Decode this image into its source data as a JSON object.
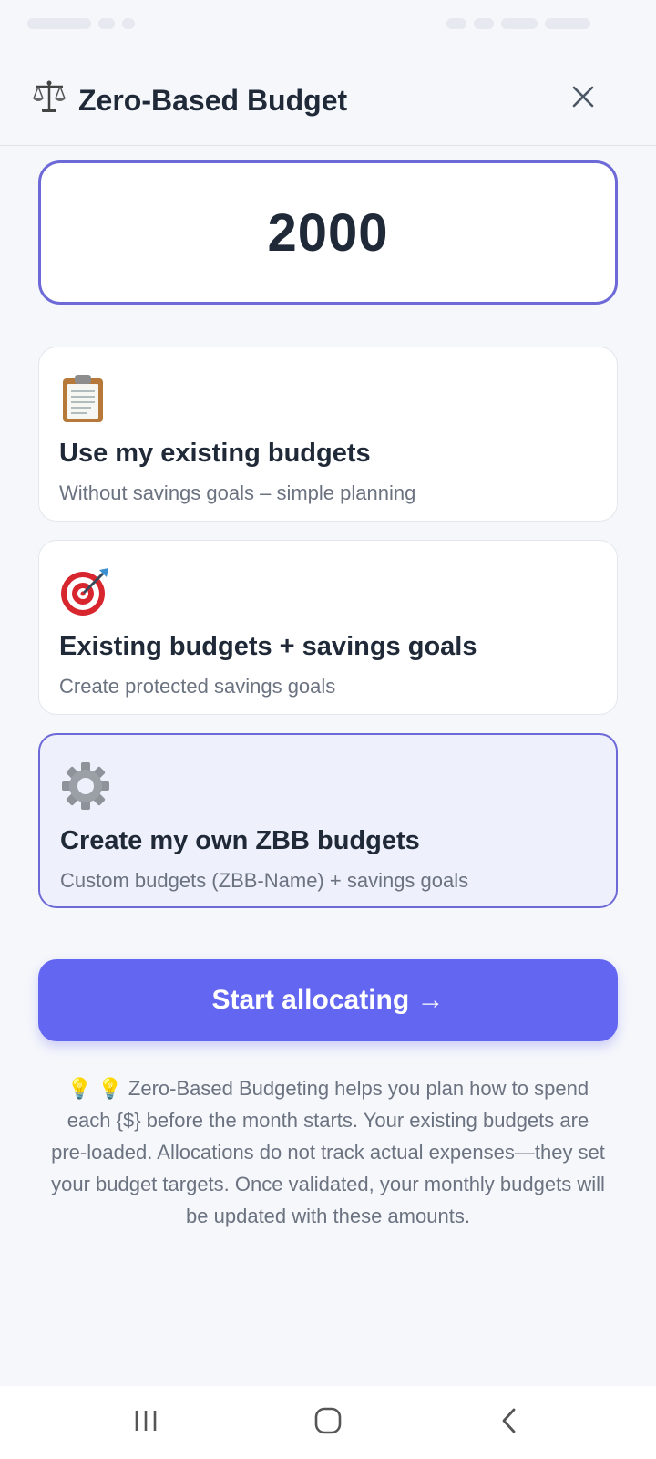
{
  "header": {
    "icon": "balance-scale-icon",
    "title": "Zero-Based Budget",
    "close_icon": "close-icon"
  },
  "amount": {
    "value": "2000"
  },
  "options": [
    {
      "icon": "clipboard-icon",
      "title": "Use my existing budgets",
      "subtitle": "Without savings goals – simple planning",
      "selected": false
    },
    {
      "icon": "target-icon",
      "title": "Existing budgets + savings goals",
      "subtitle": "Create protected savings goals",
      "selected": false
    },
    {
      "icon": "gear-icon",
      "title": "Create my own ZBB budgets",
      "subtitle": "Custom budgets (ZBB-Name) + savings goals",
      "selected": true
    }
  ],
  "start_button": {
    "label": "Start allocating →"
  },
  "info": {
    "text": "💡 💡 Zero-Based Budgeting helps you plan how to spend each {$} before the month starts. Your existing budgets are pre-loaded. Allocations do not track actual expenses—they set your budget targets. Once validated, your monthly budgets will be updated with these amounts."
  },
  "colors": {
    "accent": "#6366f1",
    "border_accent": "#6d6ad8",
    "selected_bg": "#eef0fc",
    "background": "#f5f7fb"
  },
  "nav": {
    "recent_icon": "recent-apps-icon",
    "home_icon": "home-icon",
    "back_icon": "back-icon"
  }
}
